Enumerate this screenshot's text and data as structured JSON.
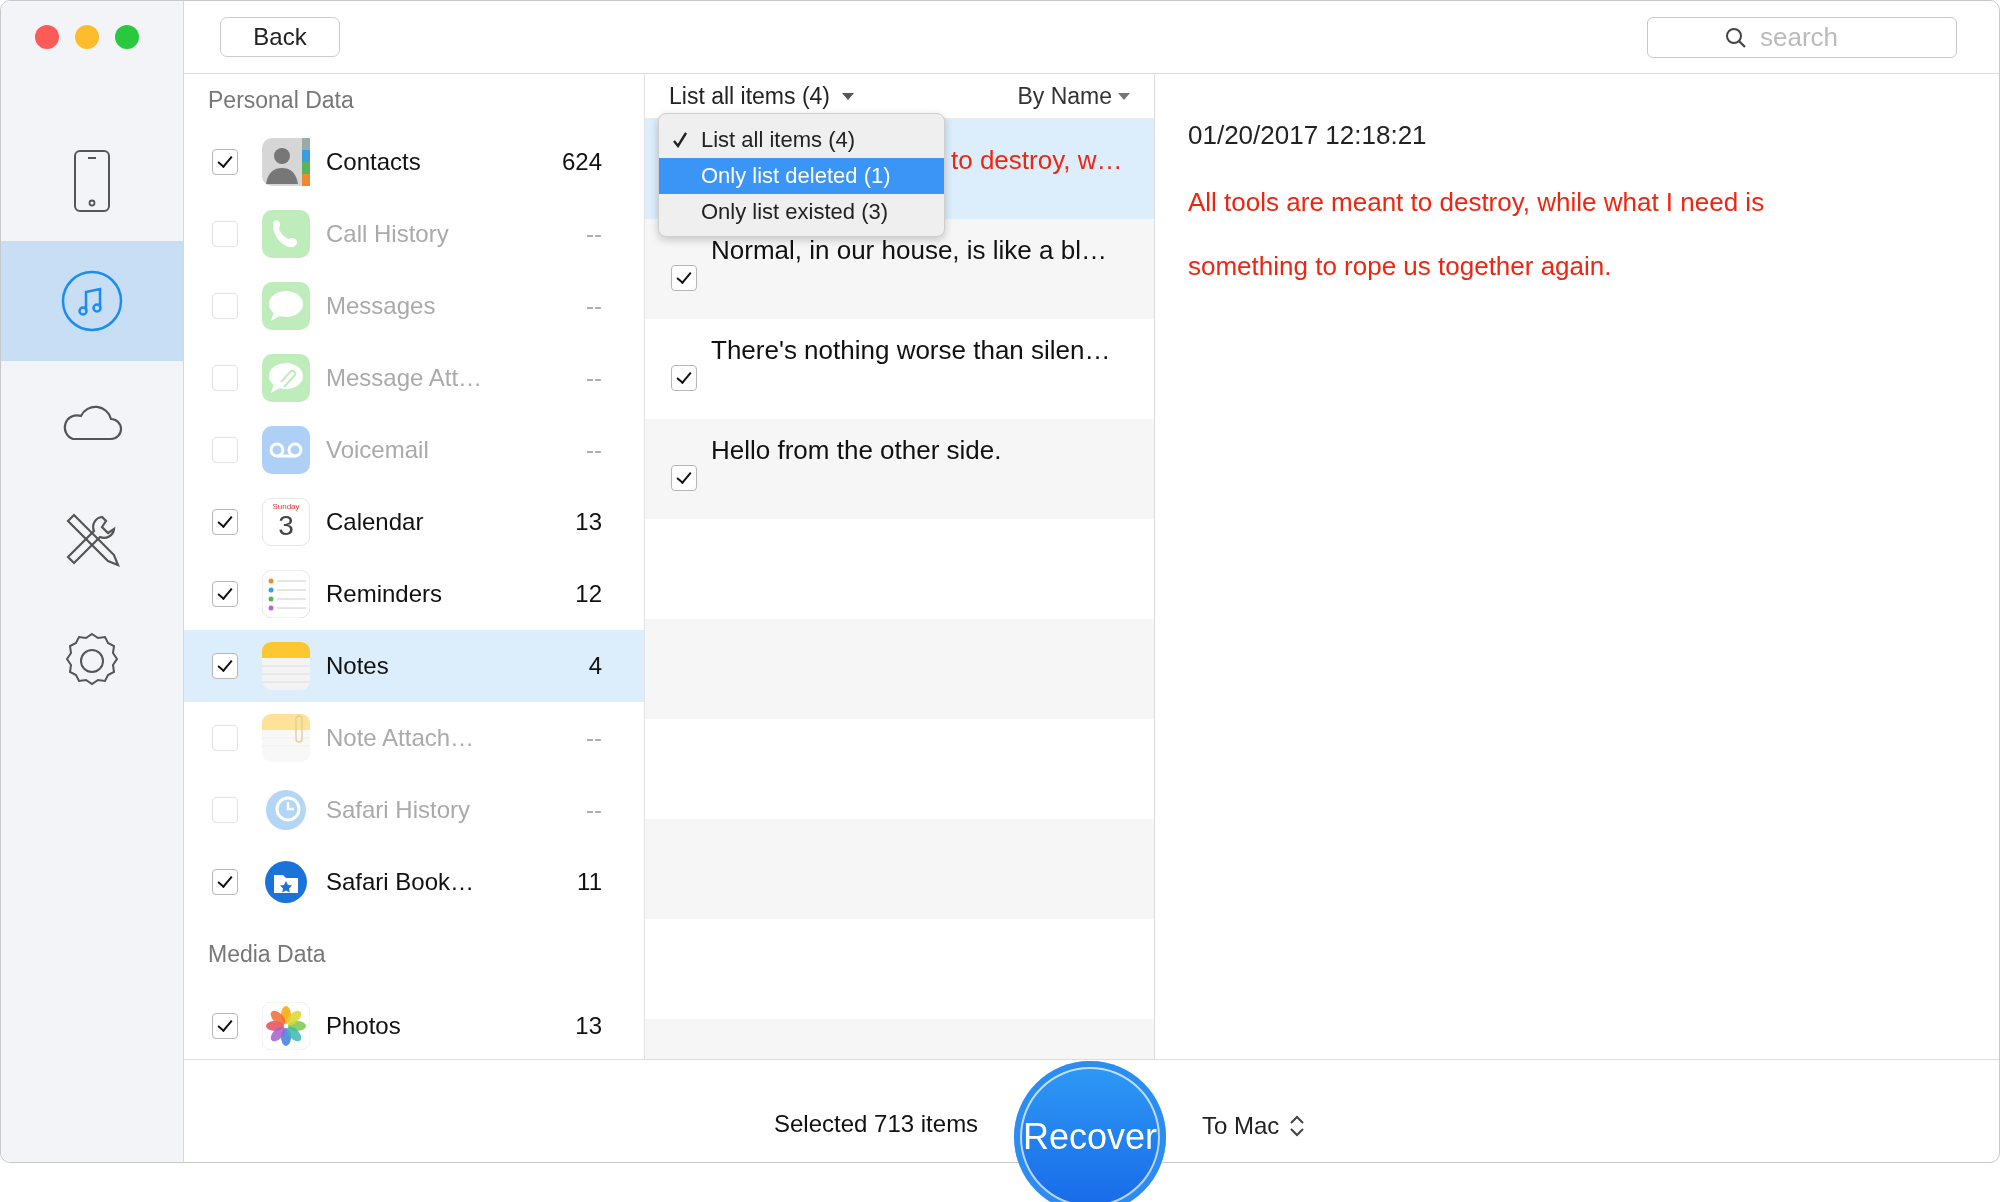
{
  "window": {
    "controls": [
      {
        "kind": "close"
      },
      {
        "kind": "minimize"
      },
      {
        "kind": "zoom"
      }
    ]
  },
  "rail": [
    {
      "kind": "device",
      "selected": false
    },
    {
      "kind": "itunes",
      "selected": true
    },
    {
      "kind": "icloud",
      "selected": false
    },
    {
      "kind": "tools",
      "selected": false
    },
    {
      "kind": "settings",
      "selected": false
    }
  ],
  "toolbar": {
    "back": "Back",
    "search": {
      "placeholder": "search"
    }
  },
  "categories": [
    {
      "heading": "Personal Data",
      "items": [
        {
          "kind": "contacts",
          "label": "Contacts",
          "count": "624",
          "checked": true,
          "disabled": false,
          "selected": false
        },
        {
          "kind": "phone",
          "label": "Call History",
          "count": "--",
          "checked": false,
          "disabled": true,
          "selected": false
        },
        {
          "kind": "messages",
          "label": "Messages",
          "count": "--",
          "checked": false,
          "disabled": true,
          "selected": false
        },
        {
          "kind": "attachment",
          "label": "Message Att…",
          "count": "--",
          "checked": false,
          "disabled": true,
          "selected": false
        },
        {
          "kind": "voicemail",
          "label": "Voicemail",
          "count": "--",
          "checked": false,
          "disabled": true,
          "selected": false
        },
        {
          "kind": "calendar",
          "label": "Calendar",
          "count": "13",
          "checked": true,
          "disabled": false,
          "selected": false,
          "icon_text": [
            "Sunday",
            "3"
          ]
        },
        {
          "kind": "reminders",
          "label": "Reminders",
          "count": "12",
          "checked": true,
          "disabled": false,
          "selected": false
        },
        {
          "kind": "notes",
          "label": "Notes",
          "count": "4",
          "checked": true,
          "disabled": false,
          "selected": true
        },
        {
          "kind": "noteattach",
          "label": "Note Attach…",
          "count": "--",
          "checked": false,
          "disabled": true,
          "selected": false
        },
        {
          "kind": "history",
          "label": "Safari History",
          "count": "--",
          "checked": false,
          "disabled": true,
          "selected": false
        },
        {
          "kind": "bookmarks",
          "label": "Safari Book…",
          "count": "11",
          "checked": true,
          "disabled": false,
          "selected": false
        }
      ]
    },
    {
      "heading": "Media Data",
      "items": [
        {
          "kind": "photos",
          "label": "Photos",
          "count": "13",
          "checked": true,
          "disabled": false,
          "selected": false
        }
      ]
    }
  ],
  "notes_list": {
    "filter": "List all items (4)",
    "sort": "By Name",
    "notes": [
      {
        "text": "to destroy, w…",
        "deleted": true,
        "selected": true,
        "covered": true
      },
      {
        "text": "Normal, in our house, is like a bl…",
        "deleted": false,
        "selected": false,
        "checked": true
      },
      {
        "text": "There's nothing worse than silen…",
        "deleted": false,
        "selected": false,
        "checked": true
      },
      {
        "text": "Hello from the other side.",
        "deleted": false,
        "selected": false,
        "checked": true
      }
    ],
    "filter_menu": [
      {
        "label": "List all items (4)",
        "checked": true,
        "highlighted": false
      },
      {
        "label": "Only list deleted (1)",
        "checked": false,
        "highlighted": true
      },
      {
        "label": "Only list existed (3)",
        "checked": false,
        "highlighted": false
      }
    ]
  },
  "detail": {
    "date": "01/20/2017 12:18:21",
    "deleted": true,
    "lines": [
      "All tools are meant to destroy, while what I need is",
      "something to rope us together again."
    ]
  },
  "bottom_bar": {
    "status": "Selected 713 items",
    "recover": "Recover",
    "destination": "To Mac"
  }
}
